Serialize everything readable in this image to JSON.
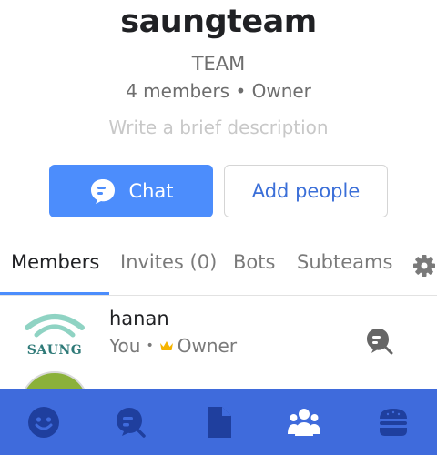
{
  "team": {
    "name": "saungteam",
    "type": "TEAM",
    "meta": "4 members • Owner",
    "description_placeholder": "Write a brief description"
  },
  "actions": {
    "chat_label": "Chat",
    "add_people_label": "Add people"
  },
  "tabs": [
    {
      "label": "Members",
      "active": true
    },
    {
      "label": "Invites (0)",
      "active": false
    },
    {
      "label": "Bots",
      "active": false
    },
    {
      "label": "Subteams",
      "active": false
    }
  ],
  "tab_settings_icon": "gear-icon",
  "members": [
    {
      "name": "hanan",
      "you_label": "You",
      "role": "Owner",
      "avatar_text": "SAUNG",
      "role_icon": "crown-icon",
      "action_icon": "chat-icon"
    }
  ],
  "bottom_nav": [
    {
      "icon": "people-icon",
      "active": false
    },
    {
      "icon": "chat-icon",
      "active": false
    },
    {
      "icon": "files-icon",
      "active": false
    },
    {
      "icon": "teams-icon",
      "active": true
    },
    {
      "icon": "menu-icon",
      "active": false
    }
  ],
  "colors": {
    "accent": "#4c8dfc",
    "bottom_bar": "#3f6bdc",
    "add_people_text": "#3b6fd8",
    "crown": "#f5b400"
  }
}
